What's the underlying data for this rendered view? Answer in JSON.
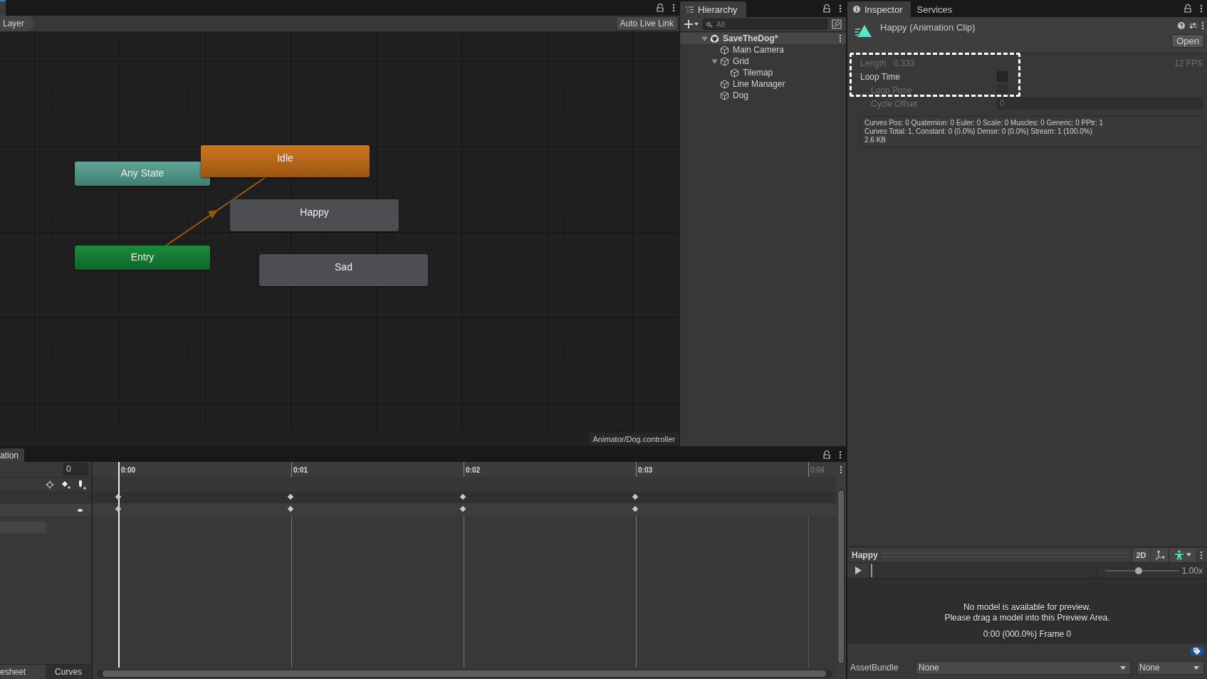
{
  "animator": {
    "breadcrumb": "Layer",
    "live_link_button": "Auto Live Link",
    "states": [
      {
        "name": "Any State",
        "kind": "any"
      },
      {
        "name": "Idle",
        "kind": "default"
      },
      {
        "name": "Happy",
        "kind": "normal"
      },
      {
        "name": "Entry",
        "kind": "entry"
      },
      {
        "name": "Sad",
        "kind": "normal"
      }
    ],
    "footer": "Animator/Dog.controller"
  },
  "hierarchy": {
    "title": "Hierarchy",
    "search": {
      "placeholder": "All"
    },
    "tree": [
      {
        "name": "SaveTheDog*",
        "kind": "scene",
        "expanded": true,
        "children": [
          {
            "name": "Main Camera",
            "kind": "object"
          },
          {
            "name": "Grid",
            "kind": "object",
            "expanded": true,
            "children": [
              {
                "name": "Tilemap",
                "kind": "object"
              }
            ]
          },
          {
            "name": "Line Manager",
            "kind": "object"
          },
          {
            "name": "Dog",
            "kind": "object"
          }
        ]
      }
    ]
  },
  "inspector": {
    "tabs": [
      {
        "label": "Inspector",
        "selected": true
      },
      {
        "label": "Services",
        "selected": false
      }
    ],
    "title": "Happy (Animation Clip)",
    "open_button": "Open",
    "length_label": "Length",
    "length_value": "0.333",
    "fps": "12 FPS",
    "properties": [
      {
        "label": "Loop Time",
        "kind": "checkbox",
        "checked": false,
        "disabled": false
      },
      {
        "label": "Loop Pose",
        "kind": "checkbox",
        "checked": false,
        "disabled": true
      },
      {
        "label": "Cycle Offset",
        "kind": "number",
        "value": "0",
        "disabled": true
      }
    ],
    "info": [
      "Curves Pos: 0 Quaternion: 0 Euler: 0 Scale: 0 Muscles: 0 Generic: 0 PPtr: 1",
      "Curves Total: 1, Constant: 0 (0.0%) Dense: 0 (0.0%) Stream: 1 (100.0%)",
      "2.6 KB"
    ],
    "preview": {
      "title": "Happy",
      "mode_button": "2D",
      "speed": {
        "level": 0.46,
        "reading": "1.00x"
      },
      "message": [
        "No model is available for preview.",
        "Please drag a model into this Preview Area."
      ],
      "time": "0:00 (000.0%) Frame 0"
    },
    "asset_bundle": {
      "label": "AssetBundle",
      "name": "None",
      "variant": "None"
    }
  },
  "animation": {
    "tab": "ation",
    "frame": "0",
    "ticks": [
      {
        "label": "0:00",
        "in_clip": true
      },
      {
        "label": "0:01",
        "in_clip": true
      },
      {
        "label": "0:02",
        "in_clip": true
      },
      {
        "label": "0:03",
        "in_clip": true
      },
      {
        "label": "0:04",
        "in_clip": false
      }
    ],
    "bottom_tabs": [
      {
        "label": "esheet",
        "selected": true
      },
      {
        "label": "Curves",
        "selected": false
      }
    ]
  }
}
